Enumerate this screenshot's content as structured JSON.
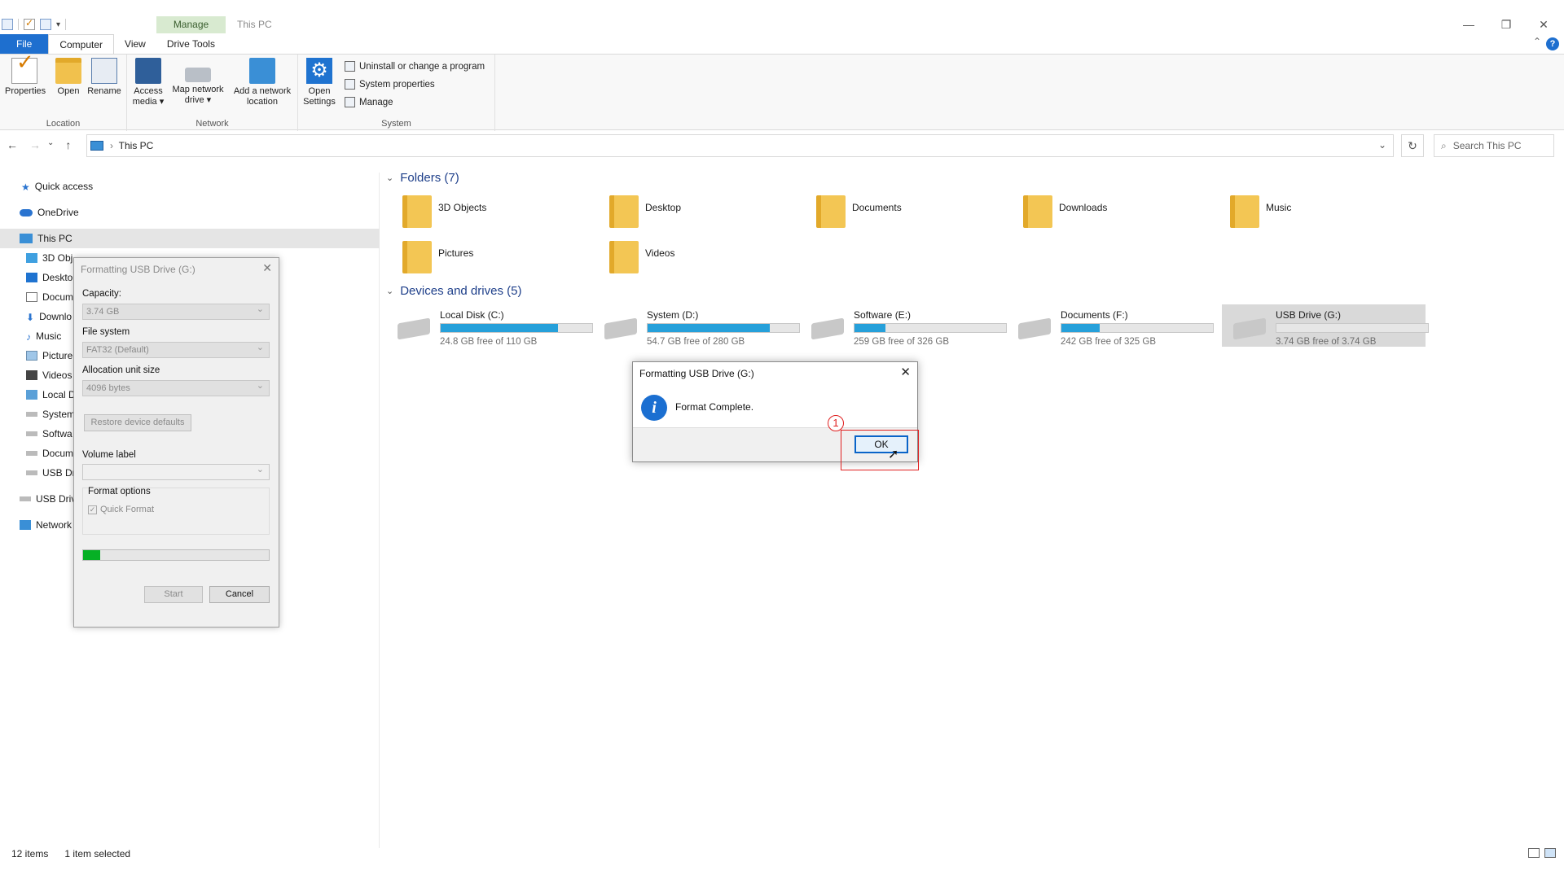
{
  "window": {
    "title": "This PC",
    "manage_label": "Manage",
    "controls": [
      "—",
      "❐",
      "✕"
    ]
  },
  "ribbon": {
    "tabs": [
      "File",
      "Computer",
      "View",
      "Drive Tools"
    ],
    "location": {
      "label": "Location",
      "buttons": [
        "Properties",
        "Open",
        "Rename"
      ]
    },
    "network": {
      "label": "Network",
      "access_media": [
        "Access",
        "media ▾"
      ],
      "map_drive": [
        "Map network",
        "drive ▾"
      ],
      "add_location": [
        "Add a network",
        "location"
      ]
    },
    "system": {
      "label": "System",
      "open_settings": [
        "Open",
        "Settings"
      ],
      "items": [
        "Uninstall or change a program",
        "System properties",
        "Manage"
      ]
    }
  },
  "address": {
    "crumb": "This PC",
    "search_placeholder": "Search This PC"
  },
  "nav": {
    "items": [
      "Quick access",
      "OneDrive",
      "This PC",
      "3D Obj",
      "Deskto",
      "Docum",
      "Downlo",
      "Music",
      "Picture",
      "Videos",
      "Local D",
      "System",
      "Softwa",
      "Docum",
      "USB Dr",
      "USB Driv",
      "Network"
    ]
  },
  "folders": {
    "heading": "Folders (7)",
    "items": [
      "3D Objects",
      "Desktop",
      "Documents",
      "Downloads",
      "Music",
      "Pictures",
      "Videos"
    ]
  },
  "drives": {
    "heading": "Devices and drives (5)",
    "items": [
      {
        "name": "Local Disk (C:)",
        "free": "24.8 GB free of 110 GB",
        "used_fraction": 0.775
      },
      {
        "name": "System (D:)",
        "free": "54.7 GB free of 280 GB",
        "used_fraction": 0.805
      },
      {
        "name": "Software (E:)",
        "free": "259 GB free of 326 GB",
        "used_fraction": 0.205
      },
      {
        "name": "Documents (F:)",
        "free": "242 GB free of 325 GB",
        "used_fraction": 0.255
      },
      {
        "name": "USB Drive (G:)",
        "free": "3.74 GB free of 3.74 GB",
        "used_fraction": 0.0
      }
    ]
  },
  "format_dialog": {
    "title": "Formatting USB Drive (G:)",
    "capacity_label": "Capacity:",
    "capacity_value": "3.74 GB",
    "fs_label": "File system",
    "fs_value": "FAT32 (Default)",
    "alloc_label": "Allocation unit size",
    "alloc_value": "4096 bytes",
    "restore_label": "Restore device defaults",
    "volume_label": "Volume label",
    "volume_value": "",
    "options_label": "Format options",
    "quick_format": "Quick Format",
    "progress_fraction": 0.09,
    "start_label": "Start",
    "cancel_label": "Cancel"
  },
  "message_box": {
    "title": "Formatting USB Drive (G:)",
    "text": "Format Complete.",
    "ok_label": "OK",
    "info_glyph": "i",
    "close_glyph": "✕"
  },
  "annotation": {
    "step": "1",
    "color": "#e02020"
  },
  "status": {
    "items": "12 items",
    "selected": "1 item selected"
  },
  "colors": {
    "accent": "#1e6fcf",
    "drive_bar": "#26a0da",
    "progress": "#06b025",
    "manage_tab": "#d8ead0"
  }
}
